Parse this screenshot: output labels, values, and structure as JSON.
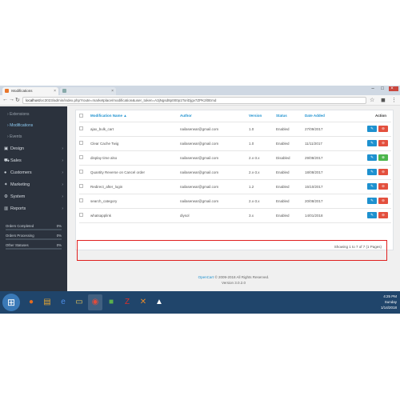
{
  "browser": {
    "tabs": [
      {
        "label": "Modifications",
        "active": true
      },
      {
        "label": "",
        "active": false
      }
    ],
    "url_host": "localhost",
    "url_path": "/oc3023/admin/index.php?route=marketplace/modification&user_token=A3jNgsd8p000p1ToriDjgv7ZPK2l0Emd"
  },
  "sidebar": {
    "items": [
      {
        "label": "Extensions",
        "sub": true,
        "active": false
      },
      {
        "label": "Modifications",
        "sub": true,
        "active": true
      },
      {
        "label": "Events",
        "sub": true,
        "active": false
      },
      {
        "label": "Design",
        "icon": "design-icon",
        "chevron": true
      },
      {
        "label": "Sales",
        "icon": "cart-icon",
        "chevron": true
      },
      {
        "label": "Customers",
        "icon": "user-icon",
        "chevron": true
      },
      {
        "label": "Marketing",
        "icon": "share-icon",
        "chevron": true
      },
      {
        "label": "System",
        "icon": "gear-icon",
        "chevron": true
      },
      {
        "label": "Reports",
        "icon": "bar-chart-icon",
        "chevron": true
      }
    ],
    "stats": [
      {
        "label": "Orders Completed",
        "pct": "0%",
        "value": 0
      },
      {
        "label": "Orders Processing",
        "pct": "0%",
        "value": 0
      },
      {
        "label": "Other Statuses",
        "pct": "0%",
        "value": 0
      }
    ]
  },
  "table": {
    "headers": {
      "name": "Modification Name ▲",
      "author": "Author",
      "version": "Version",
      "status": "Status",
      "date": "Date Added",
      "action": "Action"
    },
    "rows": [
      {
        "name": "ajax_bulk_cart",
        "author": "nailaserwar@gmail.com",
        "version": "1.0",
        "status": "Enabled",
        "date": "27/09/2017",
        "actions": [
          "edit",
          "delete"
        ]
      },
      {
        "name": "Clear Cache Twig",
        "author": "nailaserwar@gmail.com",
        "version": "1.0",
        "status": "Enabled",
        "date": "11/11/2017",
        "actions": [
          "edit",
          "delete"
        ]
      },
      {
        "name": "display time also",
        "author": "nailaserwar@gmail.com",
        "version": "2.x-3.x",
        "status": "Disabled",
        "date": "29/08/2017",
        "actions": [
          "edit",
          "enable"
        ]
      },
      {
        "name": "Quantity Reverse on Cancel order",
        "author": "nailaserwar@gmail.com",
        "version": "2.x-3.x",
        "status": "Enabled",
        "date": "18/08/2017",
        "actions": [
          "edit",
          "delete"
        ]
      },
      {
        "name": "Redirect_after_login",
        "author": "nailaserwar@gmail.com",
        "version": "1.2",
        "status": "Enabled",
        "date": "15/10/2017",
        "actions": [
          "edit",
          "delete"
        ]
      },
      {
        "name": "search_category",
        "author": "nailaserwar@gmail.com",
        "version": "2.x-3.x",
        "status": "Enabled",
        "date": "20/08/2017",
        "actions": [
          "edit",
          "delete"
        ]
      },
      {
        "name": "whatsapplink",
        "author": "diysol",
        "version": "3.x",
        "status": "Enabled",
        "date": "14/01/2018",
        "actions": [
          "edit",
          "delete"
        ]
      }
    ],
    "showing": "Showing 1 to 7 of 7 (1 Pages)"
  },
  "footer": {
    "brand": "OpenCart",
    "copyright": "© 2009-2018 All Rights Reserved.",
    "version": "Version 3.0.2.0"
  },
  "taskbar": {
    "time": "4:25 PM",
    "day": "Sunday",
    "date": "1/14/2018"
  },
  "colors": {
    "accent": "#1e91cf",
    "sidebar": "#2b323d",
    "highlight": "#e0201f",
    "taskbar": "#20456b"
  }
}
